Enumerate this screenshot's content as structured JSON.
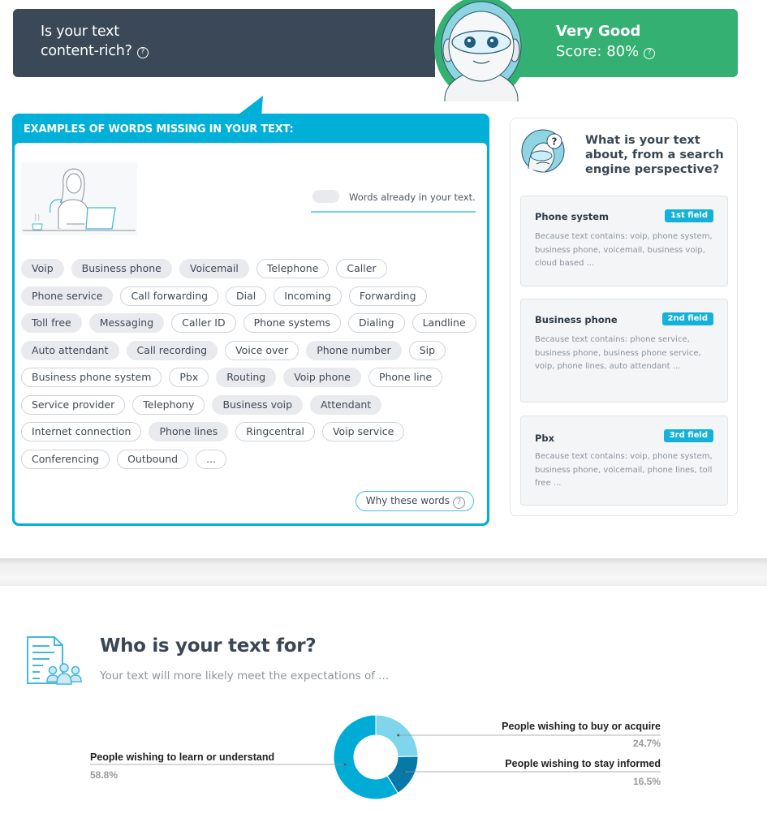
{
  "banner": {
    "question": "Is your text content-rich?",
    "question_line1": "Is your text",
    "question_line2": "content-rich?",
    "verdict": "Very Good",
    "score_label": "Score: 80%",
    "score_value": 80,
    "help_icon": "question-circle-icon",
    "colors": {
      "left": "#3a4857",
      "right": "#33b072"
    }
  },
  "missing_words": {
    "title": "EXAMPLES OF WORDS MISSING IN YOUR TEXT:",
    "legend_label": "Words already in your text.",
    "why_button": "Why these words",
    "rows": [
      [
        {
          "word": "Voip",
          "present": true
        },
        {
          "word": "Business phone",
          "present": true
        },
        {
          "word": "Voicemail",
          "present": true
        },
        {
          "word": "Telephone",
          "present": false
        },
        {
          "word": "Caller",
          "present": false
        }
      ],
      [
        {
          "word": "Phone service",
          "present": true
        },
        {
          "word": "Call forwarding",
          "present": false
        },
        {
          "word": "Dial",
          "present": false
        },
        {
          "word": "Incoming",
          "present": false
        },
        {
          "word": "Forwarding",
          "present": false
        }
      ],
      [
        {
          "word": "Toll free",
          "present": true
        },
        {
          "word": "Messaging",
          "present": true
        },
        {
          "word": "Caller ID",
          "present": false
        },
        {
          "word": "Phone systems",
          "present": false
        },
        {
          "word": "Dialing",
          "present": false
        },
        {
          "word": "Landline",
          "present": false
        }
      ],
      [
        {
          "word": "Auto attendant",
          "present": true
        },
        {
          "word": "Call recording",
          "present": true
        },
        {
          "word": "Voice over",
          "present": false
        },
        {
          "word": "Phone number",
          "present": true
        },
        {
          "word": "Sip",
          "present": false
        }
      ],
      [
        {
          "word": "Business phone system",
          "present": false
        },
        {
          "word": "Pbx",
          "present": false
        },
        {
          "word": "Routing",
          "present": true
        },
        {
          "word": "Voip phone",
          "present": true
        },
        {
          "word": "Phone line",
          "present": false
        }
      ],
      [
        {
          "word": "Service provider",
          "present": false
        },
        {
          "word": "Telephony",
          "present": false
        },
        {
          "word": "Business voip",
          "present": true
        },
        {
          "word": "Attendant",
          "present": true
        }
      ],
      [
        {
          "word": "Internet connection",
          "present": false
        },
        {
          "word": "Phone lines",
          "present": true
        },
        {
          "word": "Ringcentral",
          "present": false
        },
        {
          "word": "Voip service",
          "present": false
        }
      ],
      [
        {
          "word": "Conferencing",
          "present": false
        },
        {
          "word": "Outbound",
          "present": false
        },
        {
          "word": "...",
          "present": false
        }
      ]
    ],
    "colors": {
      "accent": "#00b0d8",
      "present_chip": "#e8eaed"
    }
  },
  "topics": {
    "title": "What is your text about, from a search engine perspective?",
    "cards": [
      {
        "name": "Phone system",
        "badge": "1st field",
        "desc": "Because text contains:   voip, phone system, business phone, voicemail, business voip, cloud based ..."
      },
      {
        "name": "Business phone",
        "badge": "2nd field",
        "desc": "Because text contains:   phone service, business phone, business phone service, voip, phone lines, auto attendant ..."
      },
      {
        "name": "Pbx",
        "badge": "3rd field",
        "desc": "Because text contains:   voip, phone system, business phone, voicemail, phone lines, toll free ..."
      }
    ]
  },
  "audience": {
    "title": "Who is your text for?",
    "subtitle": "Your text will more likely meet the expectations of ..."
  },
  "chart_data": {
    "type": "pie",
    "donut": true,
    "title": "",
    "categories": [
      "People wishing to buy or acquire",
      "People wishing to stay informed",
      "People wishing to learn or understand"
    ],
    "values": [
      24.7,
      16.5,
      58.8
    ],
    "value_labels": [
      "24.7%",
      "16.5%",
      "58.8%"
    ],
    "colors": [
      "#7fd5eb",
      "#0679a8",
      "#00acd6"
    ],
    "label_sides": [
      "right",
      "right",
      "left"
    ],
    "start": "top, clockwise"
  }
}
